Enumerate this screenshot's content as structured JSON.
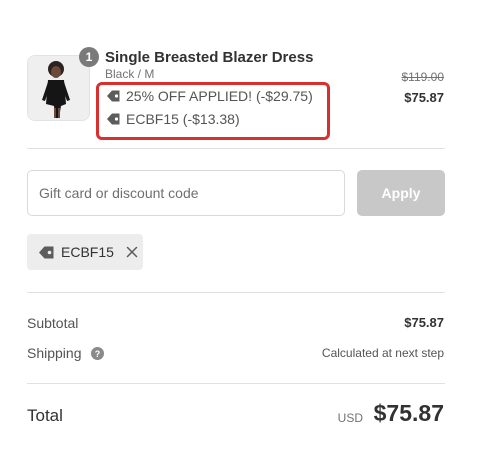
{
  "product": {
    "quantity": "1",
    "title": "Single Breasted Blazer Dress",
    "variant": "Black / M",
    "discounts": [
      {
        "icon": "tag-icon",
        "label": "25% OFF APPLIED! (-$29.75)"
      },
      {
        "icon": "tag-icon",
        "label": "ECBF15 (-$13.38)"
      }
    ],
    "original_price": "$119.00",
    "price": "$75.87"
  },
  "discount_form": {
    "placeholder": "Gift card or discount code",
    "value": "",
    "apply_label": "Apply"
  },
  "applied_code": {
    "icon": "tag-icon",
    "label": "ECBF15",
    "remove_icon": "close-icon"
  },
  "summary": {
    "subtotal_label": "Subtotal",
    "subtotal_value": "$75.87",
    "shipping_label": "Shipping",
    "shipping_help_icon": "question-circle-icon",
    "shipping_value": "Calculated at next step",
    "total_label": "Total",
    "currency": "USD",
    "total_value": "$75.87"
  },
  "colors": {
    "highlight_border": "#d92f2f",
    "apply_disabled": "#c8c8c8",
    "chip_background": "#ededed"
  }
}
